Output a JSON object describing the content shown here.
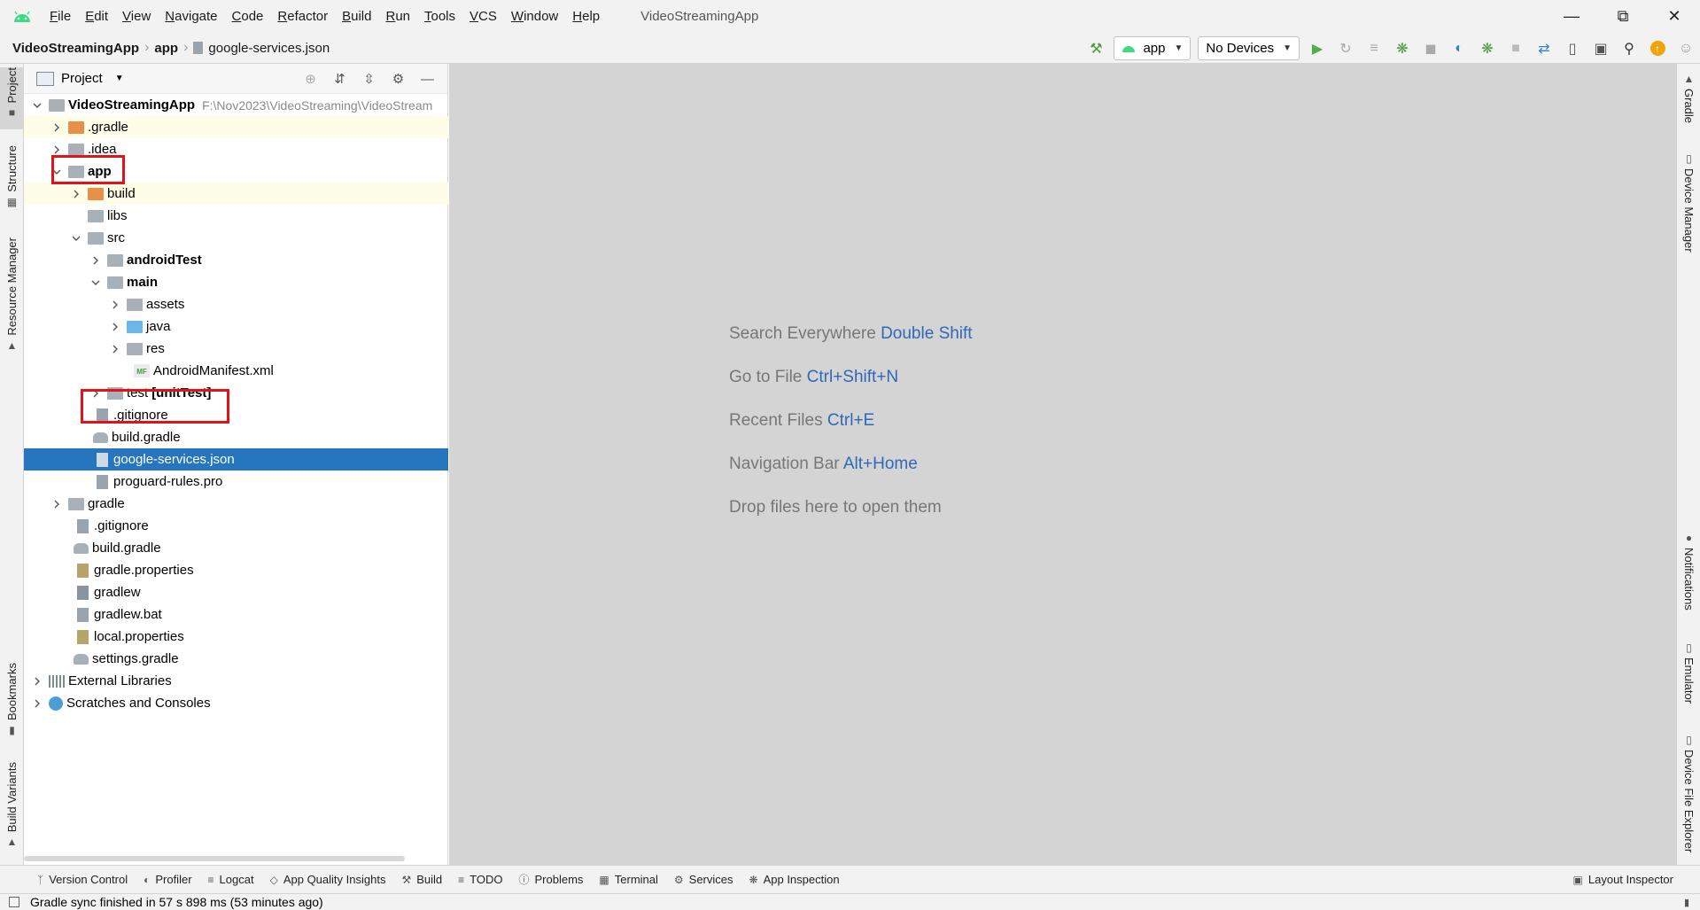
{
  "titlebar": {
    "menus": [
      "File",
      "Edit",
      "View",
      "Navigate",
      "Code",
      "Refactor",
      "Build",
      "Run",
      "Tools",
      "VCS",
      "Window",
      "Help"
    ],
    "window_title": "VideoStreamingApp",
    "controls": [
      "minimize-icon",
      "restore-icon",
      "close-icon"
    ]
  },
  "breadcrumb": {
    "project": "VideoStreamingApp",
    "module": "app",
    "file": "google-services.json"
  },
  "toolbar": {
    "run_config": "app",
    "device": "No Devices"
  },
  "project_panel": {
    "title": "Project",
    "tree": [
      {
        "label": "VideoStreamingApp",
        "hint": "F:\\Nov2023\\VideoStreaming\\VideoStream",
        "bold": true
      },
      {
        "label": ".gradle"
      },
      {
        "label": ".idea"
      },
      {
        "label": "app",
        "bold": true
      },
      {
        "label": "build"
      },
      {
        "label": "libs"
      },
      {
        "label": "src"
      },
      {
        "label": "androidTest",
        "bold": true
      },
      {
        "label": "main",
        "bold": true
      },
      {
        "label": "assets"
      },
      {
        "label": "java"
      },
      {
        "label": "res"
      },
      {
        "label": "AndroidManifest.xml"
      },
      {
        "label": "test",
        "suffix": "[unitTest]"
      },
      {
        "label": ".gitignore"
      },
      {
        "label": "build.gradle"
      },
      {
        "label": "google-services.json",
        "selected": true
      },
      {
        "label": "proguard-rules.pro"
      },
      {
        "label": "gradle"
      },
      {
        "label": ".gitignore"
      },
      {
        "label": "build.gradle"
      },
      {
        "label": "gradle.properties"
      },
      {
        "label": "gradlew"
      },
      {
        "label": "gradlew.bat"
      },
      {
        "label": "local.properties"
      },
      {
        "label": "settings.gradle"
      },
      {
        "label": "External Libraries"
      },
      {
        "label": "Scratches and Consoles"
      }
    ]
  },
  "left_tabs": [
    "Project",
    "Structure",
    "Resource Manager",
    "Bookmarks",
    "Build Variants"
  ],
  "right_tabs": [
    "Gradle",
    "Device Manager",
    "Notifications",
    "Emulator",
    "Device File Explorer"
  ],
  "editor_hints": [
    {
      "text": "Search Everywhere",
      "key": "Double Shift"
    },
    {
      "text": "Go to File",
      "key": "Ctrl+Shift+N"
    },
    {
      "text": "Recent Files",
      "key": "Ctrl+E"
    },
    {
      "text": "Navigation Bar",
      "key": "Alt+Home"
    },
    {
      "text": "Drop files here to open them",
      "key": ""
    }
  ],
  "bottom_tools": [
    "Version Control",
    "Profiler",
    "Logcat",
    "App Quality Insights",
    "Build",
    "TODO",
    "Problems",
    "Terminal",
    "Services",
    "App Inspection"
  ],
  "bottom_right_tool": "Layout Inspector",
  "status": "Gradle sync finished in 57 s 898 ms (53 minutes ago)",
  "colors": {
    "selection": "#2675bf",
    "highlight_box": "#e1121a",
    "hint_key": "#2f68b8"
  }
}
